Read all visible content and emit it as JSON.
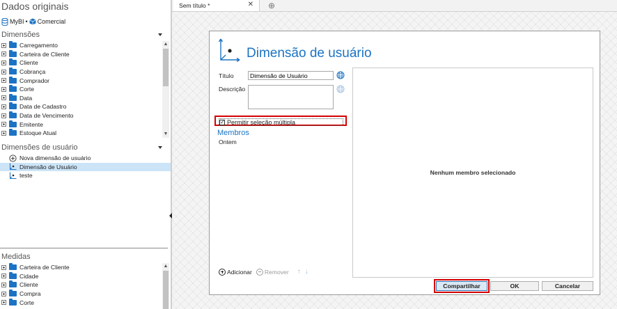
{
  "left_panel": {
    "title": "Dados originais",
    "source": {
      "db_name": "MyBI",
      "separator": "•",
      "cube_name": "Comercial"
    },
    "dimensions": {
      "title": "Dimensões",
      "items": [
        "Carregamento",
        "Carteira de Cliente",
        "Cliente",
        "Cobrança",
        "Comprador",
        "Corte",
        "Data",
        "Data de Cadastro",
        "Data de Vencimento",
        "Emitente",
        "Estoque Atual"
      ]
    },
    "user_dimensions": {
      "title": "Dimensões de usuário",
      "new_label": "Nova dimensão de usuário",
      "items": [
        {
          "label": "Dimensão de Usuário",
          "selected": true,
          "icon": "user-dimension-icon"
        },
        {
          "label": "teste",
          "selected": false,
          "icon": "user-dimension-icon"
        }
      ]
    },
    "measures": {
      "title": "Medidas",
      "items": [
        "Carteira de Cliente",
        "Cidade",
        "Cliente",
        "Compra",
        "Corte"
      ]
    }
  },
  "tabs": [
    {
      "label": "Sem título *",
      "close": "✕"
    }
  ],
  "add_tab": "⊕",
  "dialog": {
    "title": "Dimensão de usuário",
    "title_label": "Título",
    "title_value": "Dimensão de Usuário",
    "description_label": "Descrição",
    "description_value": "",
    "multi_select_label": "Permitir seleção múltipla",
    "multi_select_checked": true,
    "members_title": "Membros",
    "members": [
      "Ontem"
    ],
    "empty_message": "Nenhum membro selecionado",
    "add_label": "Adicionar",
    "remove_label": "Remover",
    "up_arrow": "↑",
    "down_arrow": "↓",
    "share_button": "Compartilhar",
    "ok_button": "OK",
    "cancel_button": "Cancelar"
  },
  "colors": {
    "accent": "#1c73c4",
    "highlight": "#d40000",
    "selection": "#cce4f7"
  }
}
